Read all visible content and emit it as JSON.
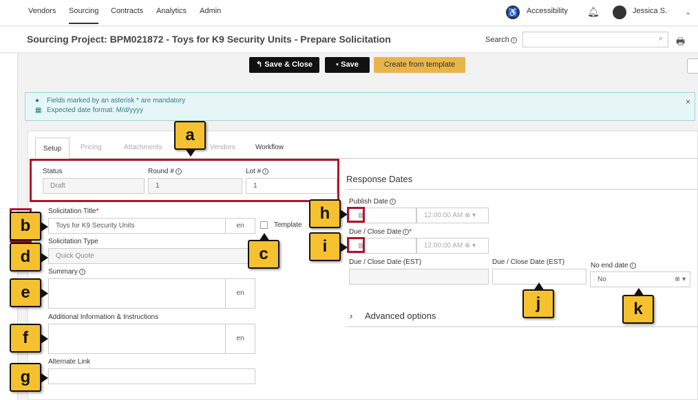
{
  "nav": {
    "items": [
      "Vendors",
      "Sourcing",
      "Contracts",
      "Analytics",
      "Admin"
    ],
    "accessibility": "Accessibility",
    "user": "Jessica S."
  },
  "header": {
    "title": "Sourcing Project: BPM021872 - Toys for K9 Security Units - Prepare Solicitation",
    "search_label": "Search"
  },
  "toolbar": {
    "save_close": "Save & Close",
    "save": "Save",
    "create_template": "Create from template"
  },
  "alert": {
    "line1": "Fields marked by an asterisk * are mandatory",
    "line2": "Expected date format: M/d/yyyy"
  },
  "tabs": [
    "Setup",
    "Pricing",
    "Attachments",
    "Vendors",
    "Workflow"
  ],
  "form": {
    "status_label": "Status",
    "status_value": "Draft",
    "round_label": "Round #",
    "round_value": "1",
    "lot_label": "Lot #",
    "lot_value": "1",
    "sol_title_label": "Solicitation Title",
    "sol_title_value": "Toys for K9 Security Units",
    "lang": "en",
    "template_label": "Template",
    "sol_type_label": "Solicitation Type",
    "sol_type_value": "Quick Quote",
    "summary_label": "Summary",
    "addl_label": "Additional Information & Instructions",
    "alt_link_label": "Alternate Link"
  },
  "response": {
    "heading": "Response Dates",
    "publish_label": "Publish Date",
    "due_label": "Due / Close Date",
    "time_value": "12:00:00 AM",
    "due_est_label": "Due / Close Date (EST)",
    "due_est2_label": "Due / Close Date (EST)",
    "no_end_label": "No end date",
    "no_end_value": "No",
    "advanced": "Advanced options"
  },
  "callouts": [
    "a",
    "b",
    "c",
    "d",
    "e",
    "f",
    "g",
    "h",
    "i",
    "j",
    "k"
  ],
  "colors": {
    "accent_red": "#b0132a",
    "callout_yellow": "#f5c12e",
    "alert_teal": "#2d7d87"
  }
}
